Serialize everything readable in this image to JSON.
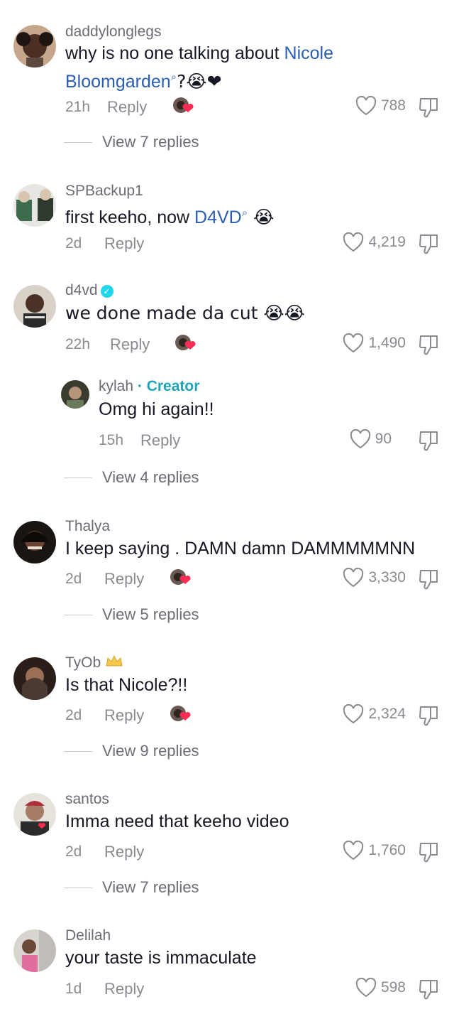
{
  "comments": [
    {
      "username": "daddylonglegs",
      "text_before": "why is no one talking about ",
      "link": "Nicole Bloomgarden",
      "text_after": "?😭❤",
      "time": "21h",
      "reply_label": "Reply",
      "likes": "788",
      "view_replies": "View 7 replies"
    },
    {
      "username": "SPBackup1",
      "text_before": "first keeho, now ",
      "link": "D4VD",
      "text_after": " 😭",
      "time": "2d",
      "reply_label": "Reply",
      "likes": "4,219"
    },
    {
      "username": "d4vd",
      "text": "we done made da cut 😭😭",
      "time": "22h",
      "reply_label": "Reply",
      "likes": "1,490",
      "reply": {
        "username": "kylah",
        "creator_label": "· Creator",
        "text": "Omg hi again!!",
        "time": "15h",
        "reply_label": "Reply",
        "likes": "90"
      },
      "view_replies": "View 4 replies"
    },
    {
      "username": "Thalya",
      "text": "I keep saying . DAMN damn DAMMMMMNN",
      "time": "2d",
      "reply_label": "Reply",
      "likes": "3,330",
      "view_replies": "View 5 replies"
    },
    {
      "username": "TyOb",
      "text": "Is that Nicole?!!",
      "time": "2d",
      "reply_label": "Reply",
      "likes": "2,324",
      "view_replies": "View 9 replies"
    },
    {
      "username": "santos",
      "text": "Imma need that keeho video",
      "time": "2d",
      "reply_label": "Reply",
      "likes": "1,760",
      "view_replies": "View 7 replies"
    },
    {
      "username": "Delilah",
      "text": "your taste is immaculate",
      "time": "1d",
      "reply_label": "Reply",
      "likes": "598"
    }
  ],
  "colors": {
    "link": "#2b5db5",
    "muted": "#8a8b91",
    "verified": "#20d5ec",
    "creator": "#1fa3b8",
    "heart": "#fe2c55"
  },
  "icons": {
    "like": "heart-outline-icon",
    "dislike": "thumbs-down-icon",
    "verified": "checkmark-icon",
    "search": "search-icon",
    "creator_liked": "creator-liked-badge-icon",
    "crown": "crown-icon"
  }
}
